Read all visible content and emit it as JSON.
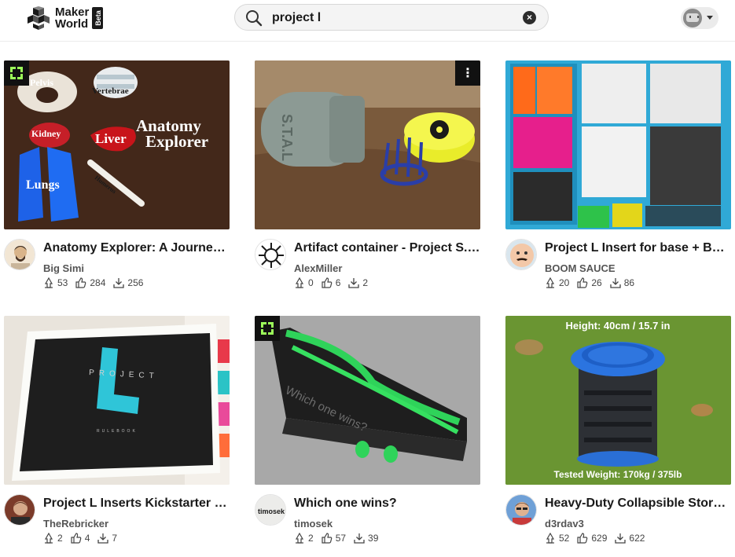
{
  "header": {
    "logo_line1": "Maker",
    "logo_line2": "World",
    "logo_badge": "Beta",
    "search": {
      "value": "project l",
      "placeholder": ""
    }
  },
  "cards": [
    {
      "title": "Anatomy Explorer: A Journey Through the Human Body",
      "author": "Big Simi",
      "boosts": "53",
      "likes": "284",
      "downloads": "256",
      "image_labels": [
        "Pelvis",
        "Vertebrae",
        "Kidney",
        "Liver",
        "Anatomy",
        "Explorer",
        "Lungs",
        "Humerus"
      ],
      "generator_badge": true
    },
    {
      "title": "Artifact container - Project S.T.A.L.K.E.R.",
      "author": "AlexMiller",
      "boosts": "0",
      "likes": "6",
      "downloads": "2",
      "image_labels": [
        "S.T.A.L"
      ]
    },
    {
      "title": "Project L Insert for base + Boost expansion",
      "author": "BOOM SAUCE",
      "boosts": "20",
      "likes": "26",
      "downloads": "86",
      "image_labels": []
    },
    {
      "title": "Project L Inserts Kickstarter Edition",
      "author": "TheRebricker",
      "boosts": "2",
      "likes": "4",
      "downloads": "7",
      "image_labels": [
        "PROJECT",
        "RULEBOOK"
      ]
    },
    {
      "title": "Which one wins?",
      "author": "timosek",
      "boosts": "2",
      "likes": "57",
      "downloads": "39",
      "image_labels": [
        "Which one wins?"
      ],
      "avatar_text": "timosek",
      "generator_badge": true
    },
    {
      "title": "Heavy-Duty Collapsible Storage Container",
      "author": "d3rdav3",
      "boosts": "52",
      "likes": "629",
      "downloads": "622",
      "image_labels": [
        "Height: 40cm / 15.7 in",
        "Tested Weight: 170kg / 375lb"
      ]
    }
  ],
  "colors": {
    "accent_green": "#00ae42",
    "text": "#1a1a1a",
    "muted": "#555555"
  }
}
